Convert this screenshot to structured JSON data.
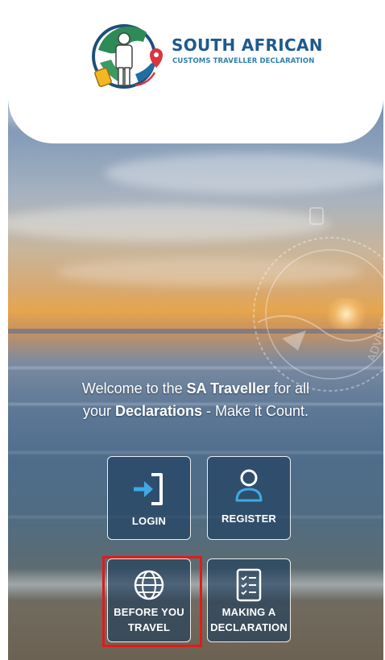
{
  "header": {
    "brand_title": "SOUTH AFRICAN",
    "brand_subtitle": "CUSTOMS TRAVELLER DECLARATION"
  },
  "welcome": {
    "line1_prefix": "Welcome to the ",
    "line1_bold": "SA Traveller",
    "line1_suffix": " for all",
    "line2_prefix": "your ",
    "line2_bold": "Declarations",
    "line2_suffix": " - Make it Count."
  },
  "tiles": {
    "login": {
      "label": "LOGIN",
      "icon": "login-icon"
    },
    "register": {
      "label": "REGISTER",
      "icon": "user-icon"
    },
    "before_travel": {
      "label_line1": "BEFORE YOU",
      "label_line2": "TRAVEL",
      "icon": "globe-icon"
    },
    "declaration": {
      "label_line1": "MAKING A",
      "label_line2": "DECLARATION",
      "icon": "checklist-icon"
    }
  },
  "watermark_text": "ADVENT URES",
  "colors": {
    "brand_blue": "#1f5a8c",
    "login_arrow": "#3fa9e6",
    "tile_bg": "#1c3c5c",
    "highlight": "#e01b1b"
  }
}
